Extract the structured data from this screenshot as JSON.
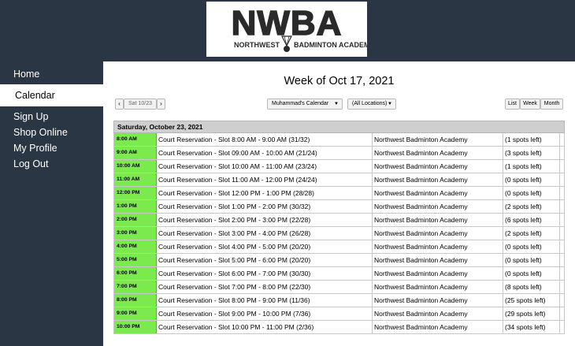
{
  "brand": {
    "logo_text": "NWBA",
    "logo_subtitle_left": "NORTHWEST",
    "logo_subtitle_right": "BADMINTON ACADEMY"
  },
  "sidebar": {
    "items": [
      {
        "label": "Home"
      },
      {
        "label": "Calendar"
      },
      {
        "label": "Sign Up"
      },
      {
        "label": "Shop Online"
      },
      {
        "label": "My Profile"
      },
      {
        "label": "Log Out"
      }
    ],
    "active": "Calendar"
  },
  "main": {
    "title": "Week of Oct 17, 2021",
    "toolbar": {
      "prev_label": "‹",
      "date_label": "Sat 10/23",
      "next_label": "›",
      "calendar_select": "Muhammad's Calendar",
      "location_select": "(All Locations)",
      "views": [
        "List",
        "Week",
        "Month"
      ]
    },
    "day_header": "Saturday, October 23, 2021",
    "rows": [
      {
        "time": "8:00 AM",
        "title": "Court Reservation - Slot 8:00 AM - 9:00 AM (31/32)",
        "location": "Northwest Badminton Academy",
        "spots": "(1 spots left)"
      },
      {
        "time": "9:00 AM",
        "title": "Court Reservation - Slot 09:00 AM - 10:00 AM (21/24)",
        "location": "Northwest Badminton Academy",
        "spots": "(3 spots left)"
      },
      {
        "time": "10:00 AM",
        "title": "Court Reservation - Slot 10:00 AM - 11:00 AM (23/24)",
        "location": "Northwest Badminton Academy",
        "spots": "(1 spots left)"
      },
      {
        "time": "11:00 AM",
        "title": "Court Reservation - Slot 11:00 AM - 12:00 PM (24/24)",
        "location": "Northwest Badminton Academy",
        "spots": "(0 spots left)"
      },
      {
        "time": "12:00 PM",
        "title": "Court Reservation - Slot 12:00 PM - 1:00 PM (28/28)",
        "location": "Northwest Badminton Academy",
        "spots": "(0 spots left)"
      },
      {
        "time": "1:00 PM",
        "title": "Court Reservation - Slot 1:00 PM - 2:00 PM (30/32)",
        "location": "Northwest Badminton Academy",
        "spots": "(2 spots left)"
      },
      {
        "time": "2:00 PM",
        "title": "Court Reservation - Slot 2:00 PM - 3:00 PM (22/28)",
        "location": "Northwest Badminton Academy",
        "spots": "(6 spots left)"
      },
      {
        "time": "3:00 PM",
        "title": "Court Reservation - Slot 3:00 PM - 4:00 PM (26/28)",
        "location": "Northwest Badminton Academy",
        "spots": "(2 spots left)"
      },
      {
        "time": "4:00 PM",
        "title": "Court Reservation - Slot 4:00 PM - 5:00 PM (20/20)",
        "location": "Northwest Badminton Academy",
        "spots": "(0 spots left)"
      },
      {
        "time": "5:00 PM",
        "title": "Court Reservation - Slot 5:00 PM - 6:00 PM (20/20)",
        "location": "Northwest Badminton Academy",
        "spots": "(0 spots left)"
      },
      {
        "time": "6:00 PM",
        "title": "Court Reservation - Slot 6:00 PM - 7:00 PM (30/30)",
        "location": "Northwest Badminton Academy",
        "spots": "(0 spots left)"
      },
      {
        "time": "7:00 PM",
        "title": "Court Reservation - Slot 7:00 PM - 8:00 PM (22/30)",
        "location": "Northwest Badminton Academy",
        "spots": "(8 spots left)"
      },
      {
        "time": "8:00 PM",
        "title": "Court Reservation - Slot 8:00 PM - 9:00 PM (11/36)",
        "location": "Northwest Badminton Academy",
        "spots": "(25 spots left)"
      },
      {
        "time": "9:00 PM",
        "title": "Court Reservation - Slot 9:00 PM - 10:00 PM (7/36)",
        "location": "Northwest Badminton Academy",
        "spots": "(29 spots left)"
      },
      {
        "time": "10:00 PM",
        "title": "Court Reservation - Slot 10:00 PM - 11:00 PM (2/36)",
        "location": "Northwest Badminton Academy",
        "spots": "(34 spots left)"
      }
    ]
  },
  "colors": {
    "header_bg": "#2b3644",
    "time_cell_green": "#7bea4d",
    "day_header_gray": "#cfcfcf"
  }
}
